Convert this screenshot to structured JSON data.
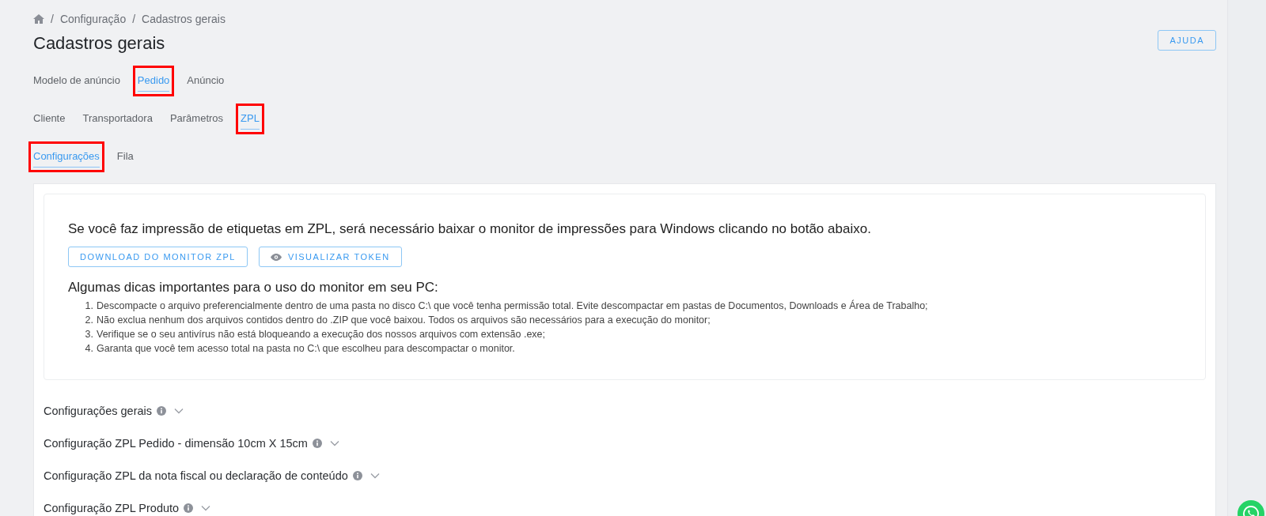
{
  "breadcrumb": [
    {
      "separator": "/",
      "label": "Configuração"
    },
    {
      "separator": "/",
      "label": "Cadastros gerais"
    }
  ],
  "title": "Cadastros gerais",
  "help_button": "AJUDA",
  "tab_rows": [
    [
      {
        "label": "Modelo de anúncio",
        "selected": false,
        "highlighted": false
      },
      {
        "label": "Pedido",
        "selected": true,
        "highlighted": true
      },
      {
        "label": "Anúncio",
        "selected": false,
        "highlighted": false
      }
    ],
    [
      {
        "label": "Cliente",
        "selected": false,
        "highlighted": false
      },
      {
        "label": "Transportadora",
        "selected": false,
        "highlighted": false
      },
      {
        "label": "Parâmetros",
        "selected": false,
        "highlighted": false
      },
      {
        "label": "ZPL",
        "selected": true,
        "highlighted": true
      }
    ],
    [
      {
        "label": "Configurações",
        "selected": true,
        "highlighted": true
      },
      {
        "label": "Fila",
        "selected": false,
        "highlighted": false
      }
    ]
  ],
  "info_card": {
    "intro": "Se você faz impressão de etiquetas em ZPL, será necessário baixar o monitor de impressões para Windows clicando no botão abaixo.",
    "buttons": [
      {
        "label": "DOWNLOAD DO MONITOR ZPL",
        "kind": "plain"
      },
      {
        "label": "VISUALIZAR TOKEN",
        "kind": "eye"
      }
    ],
    "tips_title": "Algumas dicas importantes para o uso do monitor em seu PC:",
    "tips": [
      {
        "number": "1.",
        "text": "Descompacte o arquivo preferencialmente dentro de uma pasta no disco C:\\ que você tenha permissão total. Evite descompactar em pastas de Documentos, Downloads e Área de Trabalho;"
      },
      {
        "number": "2.",
        "text": "Não exclua nenhum dos arquivos contidos dentro do .ZIP que você baixou. Todos os arquivos são necessários para a execução do monitor;"
      },
      {
        "number": "3.",
        "text": "Verifique se o seu antivírus não está bloqueando a execução dos nossos arquivos com extensão .exe;"
      },
      {
        "number": "4.",
        "text": "Garanta que você tem acesso total na pasta no C:\\ que escolheu para descompactar o monitor."
      }
    ]
  },
  "sections": [
    {
      "title": "Configurações gerais",
      "expanded": false
    },
    {
      "title": "Configuração ZPL Pedido - dimensão 10cm X 15cm",
      "expanded": false
    },
    {
      "title": "Configuração ZPL da nota fiscal ou declaração de conteúdo",
      "expanded": false
    },
    {
      "title": "Configuração ZPL Produto",
      "expanded": false
    }
  ]
}
